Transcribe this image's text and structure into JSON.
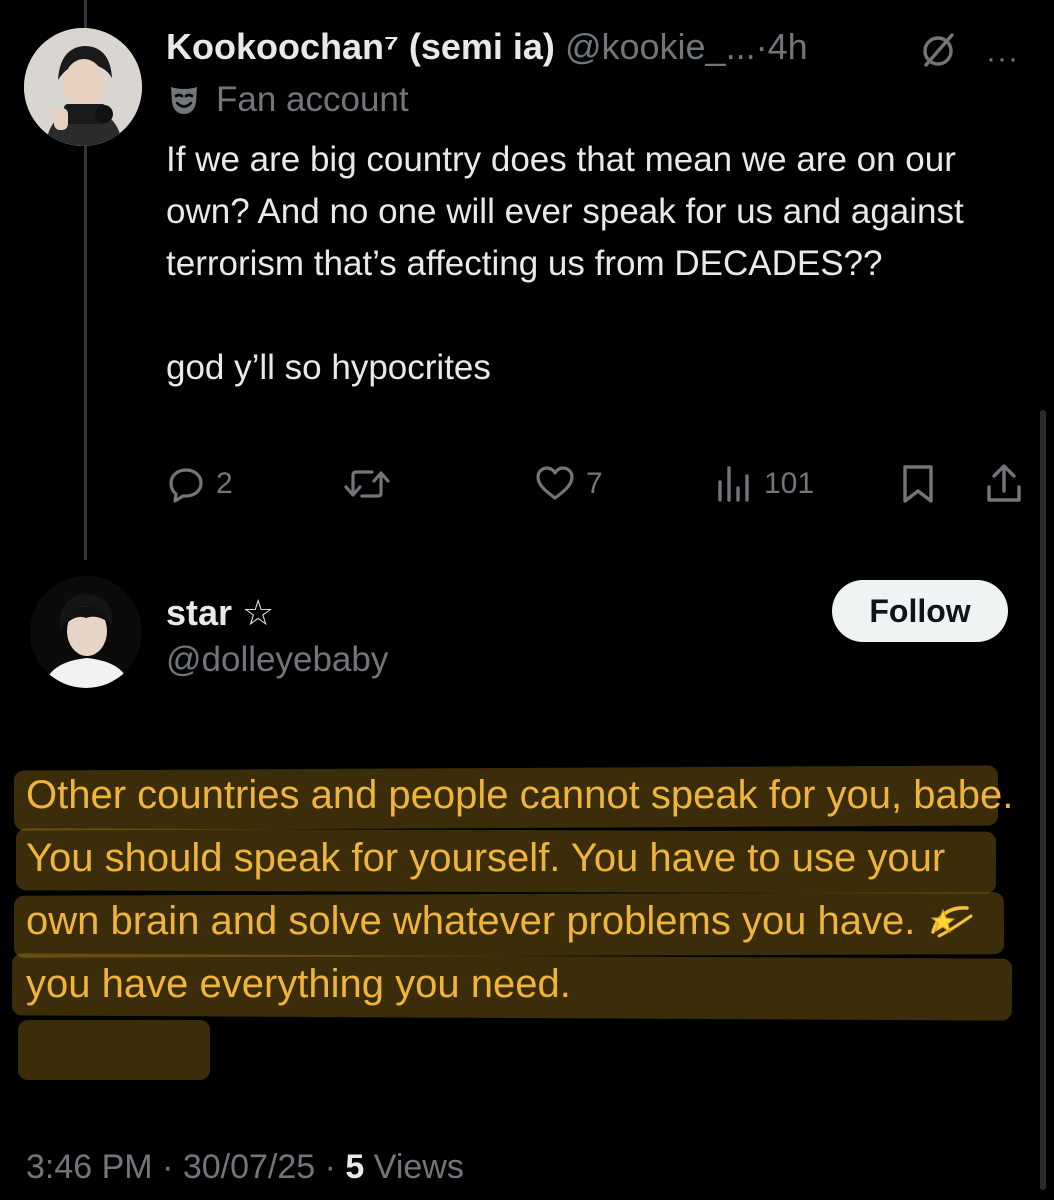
{
  "tweet": {
    "display_name": "Kookoochan⁷ (semi ia)",
    "handle": "@kookie_...",
    "separator": "·",
    "time": "4h",
    "more_label": "···",
    "label_icon": "mask-icon",
    "label": "Fan account",
    "text_paragraphs": [
      "If we are big country does that mean we are on our own? And no one will ever speak for us and against terrorism that’s affecting us from DECADES??",
      "god y’ll so hypocrites"
    ],
    "actions": {
      "replies": "2",
      "reposts": "",
      "likes": "7",
      "views": "101"
    }
  },
  "reply": {
    "display_name": "star ☆",
    "handle": "@dolleyebaby",
    "follow_label": "Follow",
    "text_part1": "Other countries and people cannot speak for you, babe. You should speak for yourself. You have to use your own brain and solve whatever problems you have. ",
    "text_emoji_icon": "dizzy-star-icon",
    "text_part2": "you have everything you need.",
    "timestamp": "3:46 PM · 30/07/25 · ",
    "views_count": "5",
    "views_label": " Views"
  },
  "colors": {
    "background": "#000000",
    "primary_text": "#e7e9ea",
    "secondary_text": "#71767b",
    "highlight_text": "#f0b43a",
    "highlight_fill": "rgba(255,196,40,0.23)"
  }
}
